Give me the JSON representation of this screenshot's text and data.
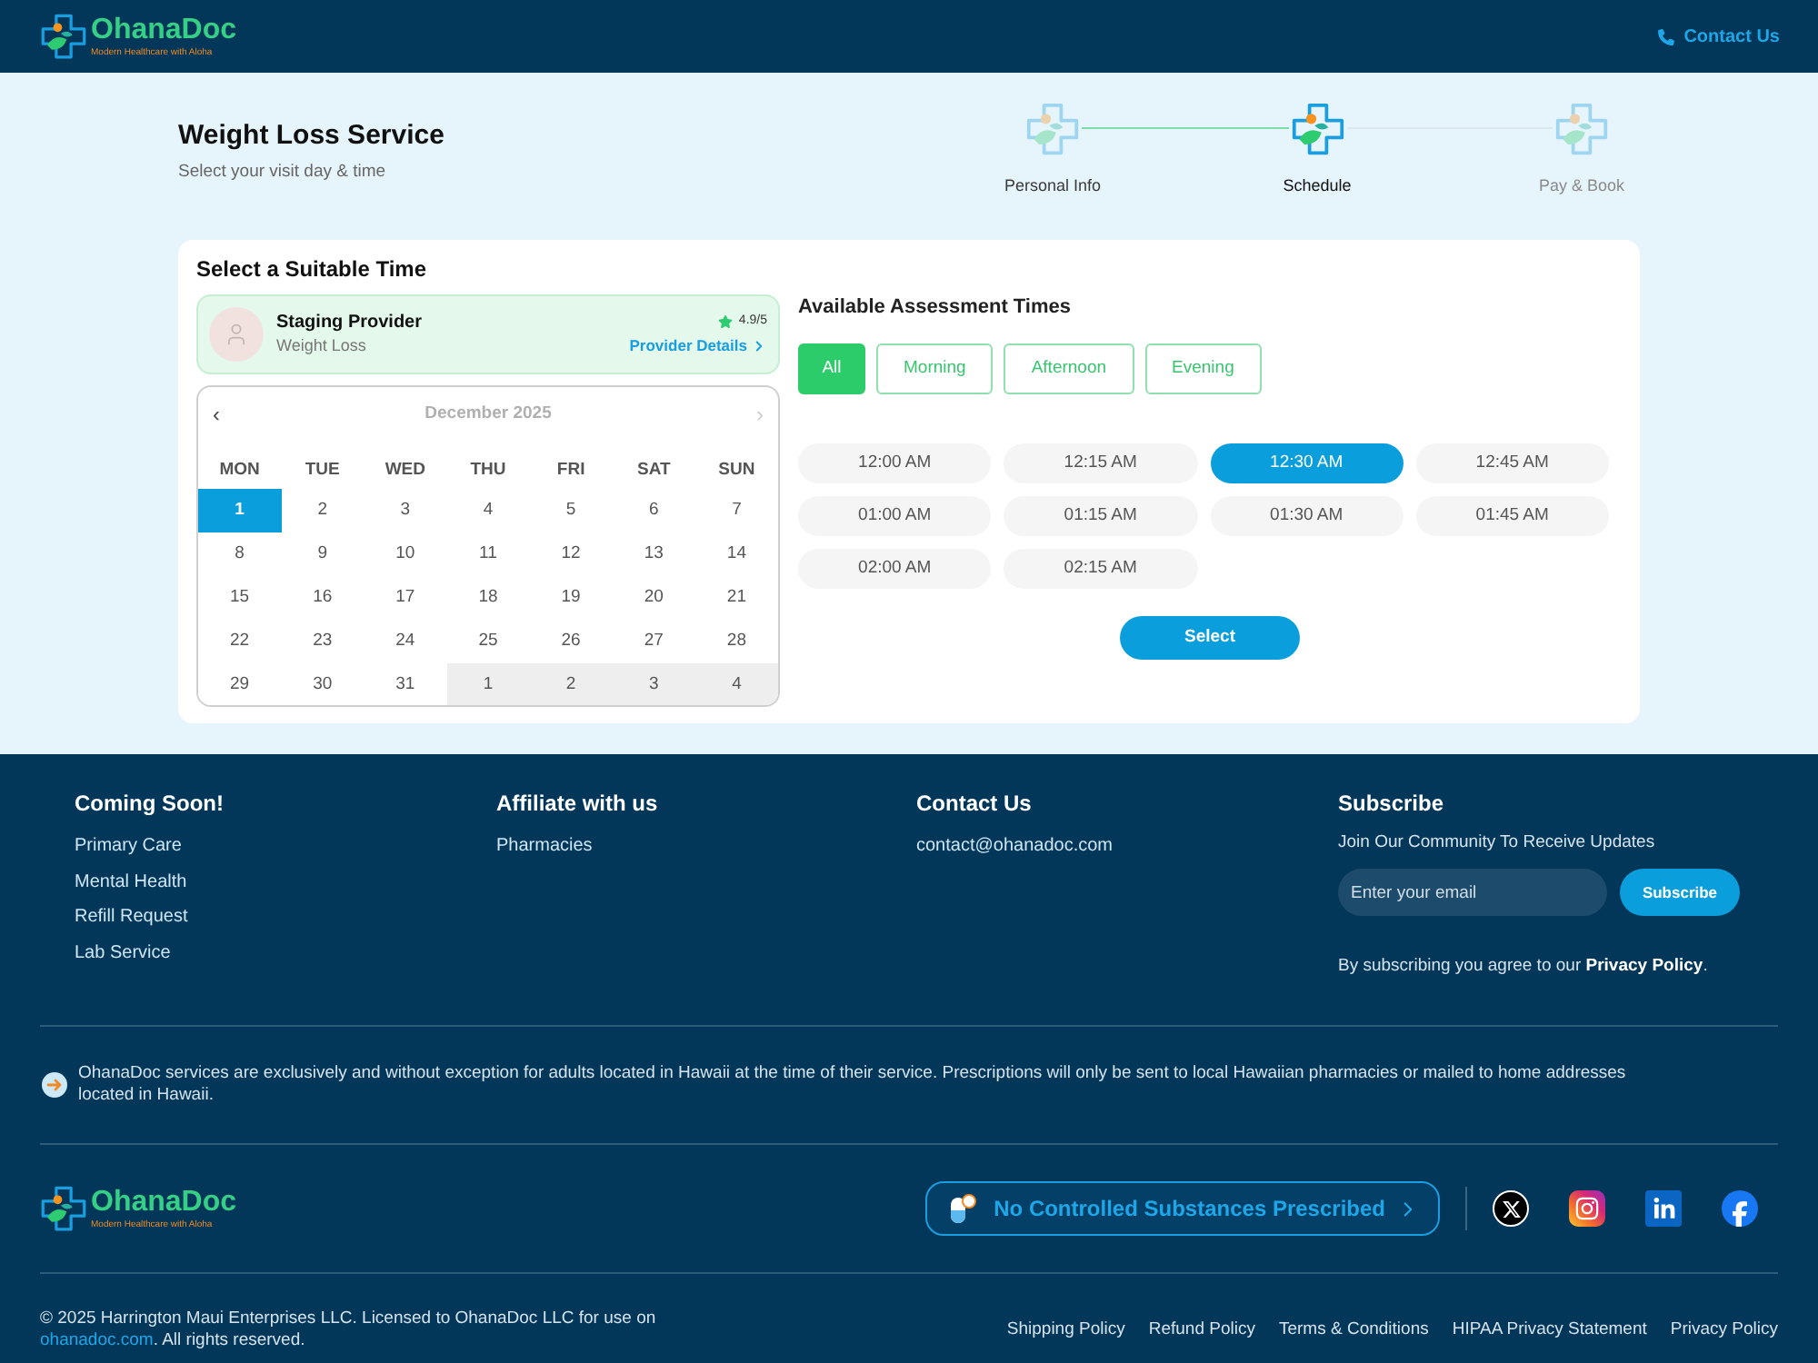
{
  "header": {
    "logo": {
      "name": "OhanaDoc",
      "tagline": "Modern Healthcare with Aloha"
    },
    "contact": "Contact Us"
  },
  "page": {
    "title": "Weight Loss Service",
    "subtitle": "Select your visit day & time"
  },
  "steps": [
    {
      "label": "Personal Info",
      "done": true,
      "active": false
    },
    {
      "label": "Schedule",
      "done": false,
      "active": true
    },
    {
      "label": "Pay & Book",
      "done": false,
      "active": false
    }
  ],
  "booking": {
    "title": "Select a Suitable Time",
    "provider": {
      "name": "Staging Provider",
      "specialty": "Weight Loss",
      "rating": "4.9/5",
      "details_link": "Provider Details"
    },
    "calendar": {
      "prev": {
        "label": "‹",
        "disabled": false
      },
      "month": "December 2025",
      "next": {
        "label": "›",
        "disabled": true
      },
      "weekdays": [
        "MON",
        "TUE",
        "WED",
        "THU",
        "FRI",
        "SAT",
        "SUN"
      ],
      "days": [
        {
          "day": "1",
          "selected": true,
          "outside": false
        },
        {
          "day": "2",
          "selected": false,
          "outside": false
        },
        {
          "day": "3",
          "selected": false,
          "outside": false
        },
        {
          "day": "4",
          "selected": false,
          "outside": false
        },
        {
          "day": "5",
          "selected": false,
          "outside": false
        },
        {
          "day": "6",
          "selected": false,
          "outside": false
        },
        {
          "day": "7",
          "selected": false,
          "outside": false
        },
        {
          "day": "8",
          "selected": false,
          "outside": false
        },
        {
          "day": "9",
          "selected": false,
          "outside": false
        },
        {
          "day": "10",
          "selected": false,
          "outside": false
        },
        {
          "day": "11",
          "selected": false,
          "outside": false
        },
        {
          "day": "12",
          "selected": false,
          "outside": false
        },
        {
          "day": "13",
          "selected": false,
          "outside": false
        },
        {
          "day": "14",
          "selected": false,
          "outside": false
        },
        {
          "day": "15",
          "selected": false,
          "outside": false
        },
        {
          "day": "16",
          "selected": false,
          "outside": false
        },
        {
          "day": "17",
          "selected": false,
          "outside": false
        },
        {
          "day": "18",
          "selected": false,
          "outside": false
        },
        {
          "day": "19",
          "selected": false,
          "outside": false
        },
        {
          "day": "20",
          "selected": false,
          "outside": false
        },
        {
          "day": "21",
          "selected": false,
          "outside": false
        },
        {
          "day": "22",
          "selected": false,
          "outside": false
        },
        {
          "day": "23",
          "selected": false,
          "outside": false
        },
        {
          "day": "24",
          "selected": false,
          "outside": false
        },
        {
          "day": "25",
          "selected": false,
          "outside": false
        },
        {
          "day": "26",
          "selected": false,
          "outside": false
        },
        {
          "day": "27",
          "selected": false,
          "outside": false
        },
        {
          "day": "28",
          "selected": false,
          "outside": false
        },
        {
          "day": "29",
          "selected": false,
          "outside": false
        },
        {
          "day": "30",
          "selected": false,
          "outside": false
        },
        {
          "day": "31",
          "selected": false,
          "outside": false
        },
        {
          "day": "1",
          "selected": false,
          "outside": true
        },
        {
          "day": "2",
          "selected": false,
          "outside": true
        },
        {
          "day": "3",
          "selected": false,
          "outside": true
        },
        {
          "day": "4",
          "selected": false,
          "outside": true
        }
      ]
    },
    "times": {
      "title": "Available Assessment Times",
      "filters": [
        {
          "label": "All",
          "selected": true
        },
        {
          "label": "Morning",
          "selected": false
        },
        {
          "label": "Afternoon",
          "selected": false
        },
        {
          "label": "Evening",
          "selected": false
        }
      ],
      "slots": [
        {
          "label": "12:00 AM",
          "selected": false
        },
        {
          "label": "12:15 AM",
          "selected": false
        },
        {
          "label": "12:30 AM",
          "selected": true
        },
        {
          "label": "12:45 AM",
          "selected": false
        },
        {
          "label": "01:00 AM",
          "selected": false
        },
        {
          "label": "01:15 AM",
          "selected": false
        },
        {
          "label": "01:30 AM",
          "selected": false
        },
        {
          "label": "01:45 AM",
          "selected": false
        },
        {
          "label": "02:00 AM",
          "selected": false
        },
        {
          "label": "02:15 AM",
          "selected": false
        }
      ],
      "action": "Select"
    }
  },
  "footer": {
    "columns": [
      {
        "heading": "Coming Soon!",
        "links": [
          "Primary Care",
          "Mental Health",
          "Refill Request",
          "Lab Service"
        ]
      },
      {
        "heading": "Affiliate with us",
        "links": [
          "Pharmacies"
        ]
      },
      {
        "heading": "Contact Us",
        "links": [
          "contact@ohanadoc.com"
        ]
      }
    ],
    "subscribe": {
      "heading": "Subscribe",
      "text": "Join Our Community To Receive Updates",
      "placeholder": "Enter your email",
      "button": "Subscribe",
      "consent": {
        "text": "By subscribing you agree to our",
        "link": "Privacy Policy",
        "end": "."
      }
    },
    "disclaimer": "OhanaDoc services are exclusively and without exception for adults located in Hawaii at the time of their service. Prescriptions will only be sent to local Hawaiian pharmacies or mailed to home addresses located in Hawaii.",
    "logo": {
      "name": "OhanaDoc",
      "tagline": "Modern Healthcare with Aloha"
    },
    "badge": "No Controlled Substances Prescribed",
    "copyright": {
      "text": "© 2025 Harrington Maui Enterprises LLC. Licensed to OhanaDoc LLC for use on",
      "link": "ohanadoc.com",
      "end": ". All rights reserved."
    },
    "legal_links": [
      "Shipping Policy",
      "Refund Policy",
      "Terms & Conditions",
      "HIPAA Privacy Statement",
      "Privacy Policy"
    ]
  }
}
